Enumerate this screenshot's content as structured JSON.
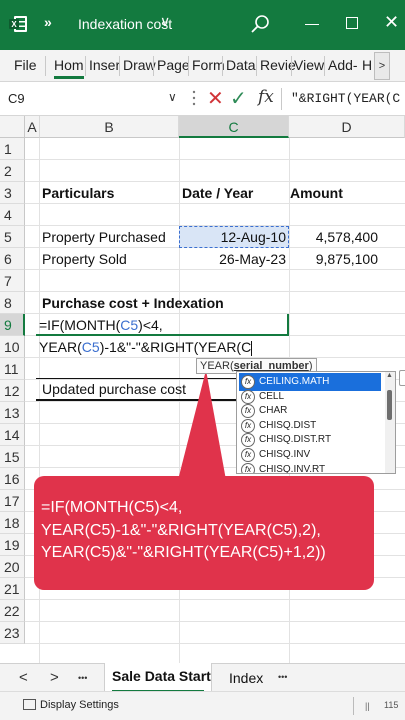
{
  "app": {
    "title": "Indexation cost",
    "chevron": "»",
    "title_caret": "∨",
    "icons": {
      "logo": "excel-logo-icon",
      "search": "search-icon",
      "minimize": "minimize-icon",
      "maximize": "maximize-icon",
      "close": "close-icon"
    },
    "accent": "#137a3f"
  },
  "ribbon": {
    "tabs": [
      "File",
      "Hom",
      "Inser",
      "Draw",
      "Page",
      "Form",
      "Data",
      "Revie",
      "View",
      "Add-",
      "H"
    ],
    "more": ">"
  },
  "formula_bar": {
    "name_box": "C9",
    "caret": "∨",
    "formula": "\"&RIGHT(YEAR(C"
  },
  "columns": [
    "A",
    "B",
    "C",
    "D"
  ],
  "rows": [
    "1",
    "2",
    "3",
    "4",
    "5",
    "6",
    "7",
    "8",
    "9",
    "10",
    "11",
    "12",
    "13",
    "14",
    "15",
    "16",
    "17",
    "18",
    "19",
    "20",
    "21",
    "22",
    "23"
  ],
  "cells": {
    "particulars": "Particulars",
    "date_year": "Date / Year",
    "amount": "Amount",
    "purchased_label": "Property Purchased",
    "purchased_date": "12-Aug-10",
    "purchased_amount": "4,578,400",
    "sold_label": "Property Sold",
    "sold_date": "26-May-23",
    "sold_amount": "9,875,100",
    "purchase_header": "Purchase cost + Indexation",
    "edit_line1_a": "=IF(MONTH(",
    "edit_line1_ref": "C5",
    "edit_line1_b": ")<4,",
    "edit_line2_a": "YEAR(",
    "edit_line2_ref": "C5",
    "edit_line2_b": ")-1&\"-\"&RIGHT(YEAR(C",
    "updated_label": "Updated purchase cost"
  },
  "tooltip": {
    "func": "YEAR(",
    "arg": "serial_number",
    "close": ")"
  },
  "autocomplete": {
    "items": [
      "CEILING.MATH",
      "CELL",
      "CHAR",
      "CHISQ.DIST",
      "CHISQ.DIST.RT",
      "CHISQ.INV",
      "CHISQ.INV.RT"
    ],
    "icon_glyph": "fx"
  },
  "callout": {
    "lines": [
      "=IF(MONTH(C5)<4,",
      "YEAR(C5)-1&\"-\"&RIGHT(YEAR(C5),2),",
      "YEAR(C5)&\"-\"&RIGHT(YEAR(C5)+1,2))"
    ],
    "color": "#e0334b"
  },
  "sheets": {
    "prev": "<",
    "next": ">",
    "more": "•••",
    "tabs": [
      "Sale Data Start",
      "Index"
    ],
    "active": "Sale Data Start"
  },
  "status": {
    "display_settings": "Display Settings",
    "zoom": "115"
  }
}
